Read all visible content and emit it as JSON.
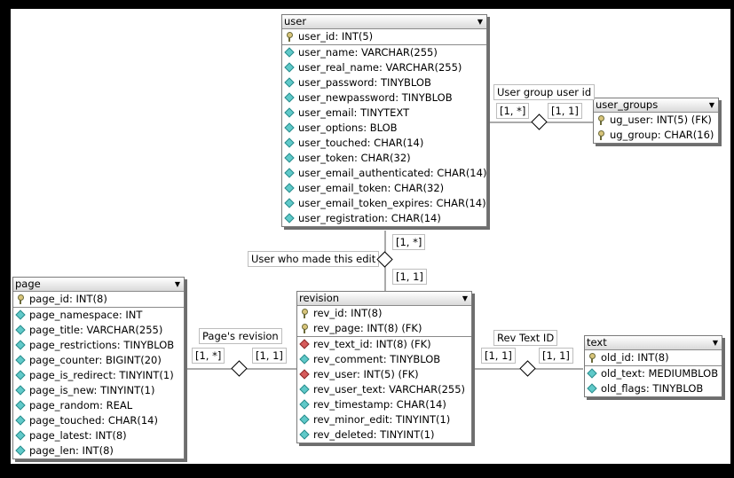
{
  "tables": {
    "user": {
      "title": "user",
      "pk": [
        "user_id: INT(5)"
      ],
      "cols": [
        "user_name: VARCHAR(255)",
        "user_real_name: VARCHAR(255)",
        "user_password: TINYBLOB",
        "user_newpassword: TINYBLOB",
        "user_email: TINYTEXT",
        "user_options: BLOB",
        "user_touched: CHAR(14)",
        "user_token: CHAR(32)",
        "user_email_authenticated: CHAR(14)",
        "user_email_token: CHAR(32)",
        "user_email_token_expires: CHAR(14)",
        "user_registration: CHAR(14)"
      ]
    },
    "user_groups": {
      "title": "user_groups",
      "pk": [
        "ug_user: INT(5) (FK)",
        "ug_group: CHAR(16)"
      ]
    },
    "page": {
      "title": "page",
      "pk": [
        "page_id: INT(8)"
      ],
      "cols": [
        "page_namespace: INT",
        "page_title: VARCHAR(255)",
        "page_restrictions: TINYBLOB",
        "page_counter: BIGINT(20)",
        "page_is_redirect: TINYINT(1)",
        "page_is_new: TINYINT(1)",
        "page_random: REAL",
        "page_touched: CHAR(14)",
        "page_latest: INT(8)",
        "page_len: INT(8)"
      ]
    },
    "revision": {
      "title": "revision",
      "pk": [
        "rev_id: INT(8)",
        "rev_page: INT(8) (FK)"
      ],
      "cols": [
        "rev_text_id: INT(8) (FK)",
        "rev_comment: TINYBLOB",
        "rev_user: INT(5) (FK)",
        "rev_user_text: VARCHAR(255)",
        "rev_timestamp: CHAR(14)",
        "rev_minor_edit: TINYINT(1)",
        "rev_deleted: TINYINT(1)"
      ]
    },
    "text": {
      "title": "text",
      "pk": [
        "old_id: INT(8)"
      ],
      "cols": [
        "old_text: MEDIUMBLOB",
        "old_flags: TINYBLOB"
      ]
    }
  },
  "relationships": {
    "user_groups": {
      "label": "User group user id",
      "card_left": "[1, *]",
      "card_right": "[1, 1]"
    },
    "user_revision": {
      "label": "User who made this edit",
      "card_top": "[1, *]",
      "card_bottom": "[1, 1]"
    },
    "page_revision": {
      "label": "Page's revision",
      "card_left": "[1, *]",
      "card_right": "[1, 1]"
    },
    "rev_text": {
      "label": "Rev Text ID",
      "card_left": "[1, 1]",
      "card_right": "[1, 1]"
    }
  },
  "icons": {
    "primary_key": "key-icon",
    "column": "cyan-diamond-icon",
    "foreign_key": "red-diamond-icon",
    "dropdown": "chevron-down-icon"
  }
}
